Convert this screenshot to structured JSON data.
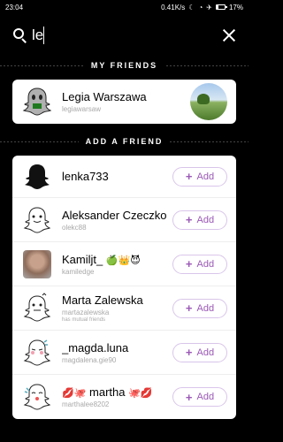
{
  "status": {
    "time": "23:04",
    "speed": "0.41K/s",
    "battery": "17%"
  },
  "search": {
    "query": "le"
  },
  "my_friends": {
    "header": "MY FRIENDS",
    "items": [
      {
        "name": "Legia Warszawa",
        "username": "legiawarsaw"
      }
    ]
  },
  "add_friend": {
    "header": "ADD A FRIEND",
    "button_label": "Add",
    "items": [
      {
        "name": "lenka733",
        "username": "",
        "extra": ""
      },
      {
        "name": "Aleksander Czeczko",
        "username": "olekc88",
        "extra": ""
      },
      {
        "name": "Kamiljt_",
        "emojis": "🍏👑😈",
        "username": "kamiledge",
        "extra": ""
      },
      {
        "name": "Marta Zalewska",
        "username": "martazalewska",
        "extra": "has mutual friends"
      },
      {
        "name": "_magda.luna",
        "username": "magdalena.gie90",
        "extra": ""
      },
      {
        "name": "martha",
        "pre": "💋🐙",
        "post": "🐙💋",
        "username": "marthalee8202",
        "extra": ""
      }
    ]
  }
}
